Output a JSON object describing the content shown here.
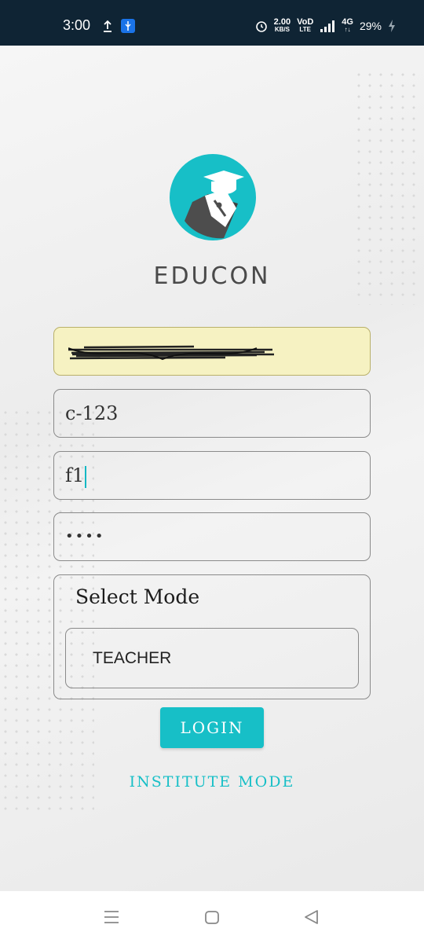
{
  "status_bar": {
    "time": "3:00",
    "speed_value": "2.00",
    "speed_unit": "KB/S",
    "volte_top": "VoD",
    "volte_bottom": "LTE",
    "network": "4G",
    "battery": "29%",
    "icons": [
      "upload-icon",
      "usb-icon",
      "alarm-icon",
      "signal-icon",
      "mobile-data-icon",
      "charging-icon"
    ]
  },
  "app": {
    "brand": "EDUCON",
    "logo_color": "#17bfc7"
  },
  "form": {
    "email": {
      "value": "",
      "obscured": true
    },
    "code": {
      "value": "c-123"
    },
    "field3": {
      "value": "f1"
    },
    "password": {
      "value": "••••"
    },
    "mode": {
      "label": "Select Mode",
      "selected": "TEACHER"
    },
    "login_label": "LOGIN",
    "institute_label": "INSTITUTE MODE"
  },
  "colors": {
    "accent": "#17bfc7",
    "autofill": "#f6f2c2",
    "status_bar": "#0f2434"
  },
  "nav_bar": {
    "icons": [
      "recents-icon",
      "home-icon",
      "back-icon"
    ]
  }
}
